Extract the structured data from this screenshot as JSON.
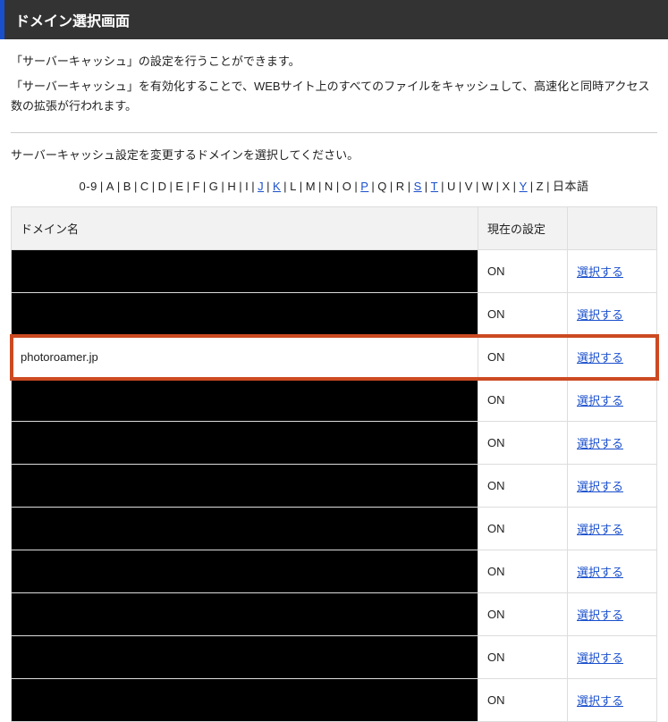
{
  "header": {
    "title": "ドメイン選択画面"
  },
  "description": {
    "line1": "「サーバーキャッシュ」の設定を行うことができます。",
    "line2": "「サーバーキャッシュ」を有効化することで、WEBサイト上のすべてのファイルをキャッシュして、高速化と同時アクセス数の拡張が行われます。"
  },
  "instruction": "サーバーキャッシュ設定を変更するドメインを選択してください。",
  "alpha_nav": [
    {
      "label": "0-9",
      "link": false
    },
    {
      "label": "A",
      "link": false
    },
    {
      "label": "B",
      "link": false
    },
    {
      "label": "C",
      "link": false
    },
    {
      "label": "D",
      "link": false
    },
    {
      "label": "E",
      "link": false
    },
    {
      "label": "F",
      "link": false
    },
    {
      "label": "G",
      "link": false
    },
    {
      "label": "H",
      "link": false
    },
    {
      "label": "I",
      "link": false
    },
    {
      "label": "J",
      "link": true
    },
    {
      "label": "K",
      "link": true
    },
    {
      "label": "L",
      "link": false
    },
    {
      "label": "M",
      "link": false
    },
    {
      "label": "N",
      "link": false
    },
    {
      "label": "O",
      "link": false
    },
    {
      "label": "P",
      "link": true
    },
    {
      "label": "Q",
      "link": false
    },
    {
      "label": "R",
      "link": false
    },
    {
      "label": "S",
      "link": true
    },
    {
      "label": "T",
      "link": true
    },
    {
      "label": "U",
      "link": false
    },
    {
      "label": "V",
      "link": false
    },
    {
      "label": "W",
      "link": false
    },
    {
      "label": "X",
      "link": false
    },
    {
      "label": "Y",
      "link": true
    },
    {
      "label": "Z",
      "link": false
    },
    {
      "label": "日本語",
      "link": false
    }
  ],
  "table": {
    "headers": {
      "domain": "ドメイン名",
      "status": "現在の設定",
      "action": ""
    },
    "action_label": "選択する",
    "rows": [
      {
        "domain": "",
        "redacted": true,
        "status": "ON",
        "highlight": false
      },
      {
        "domain": "",
        "redacted": true,
        "status": "ON",
        "highlight": false
      },
      {
        "domain": "photoroamer.jp",
        "redacted": false,
        "status": "ON",
        "highlight": true
      },
      {
        "domain": "",
        "redacted": true,
        "status": "ON",
        "highlight": false
      },
      {
        "domain": "",
        "redacted": true,
        "status": "ON",
        "highlight": false
      },
      {
        "domain": "",
        "redacted": true,
        "status": "ON",
        "highlight": false
      },
      {
        "domain": "",
        "redacted": true,
        "status": "ON",
        "highlight": false
      },
      {
        "domain": "",
        "redacted": true,
        "status": "ON",
        "highlight": false
      },
      {
        "domain": "",
        "redacted": true,
        "status": "ON",
        "highlight": false
      },
      {
        "domain": "",
        "redacted": true,
        "status": "ON",
        "highlight": false
      },
      {
        "domain": "",
        "redacted": true,
        "status": "ON",
        "highlight": false
      }
    ]
  }
}
